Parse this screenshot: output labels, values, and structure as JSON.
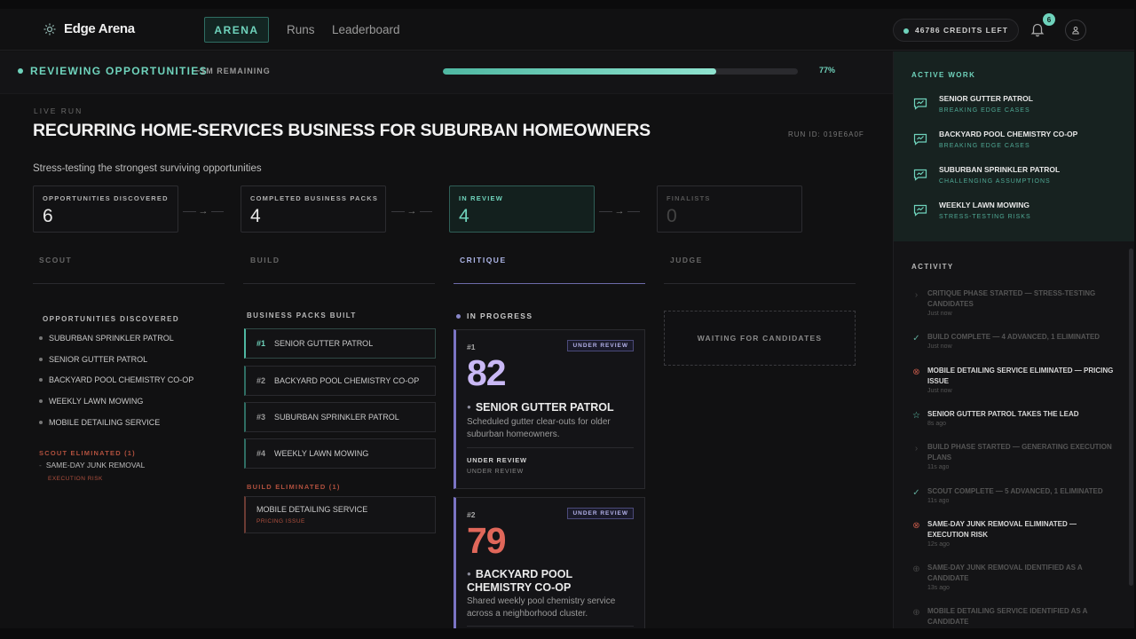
{
  "nav": {
    "brand": "Edge Arena",
    "tabs": [
      {
        "label": "ARENA",
        "active": true
      },
      {
        "label": "Runs"
      },
      {
        "label": "Leaderboard"
      }
    ],
    "credits": "46786 CREDITS LEFT",
    "notification_count": "6",
    "accent_color": "#6fd3bc"
  },
  "progress": {
    "title": "REVIEWING OPPORTUNITIES",
    "remaining": "~1M REMAINING",
    "percent_label": "77%",
    "percent_value": 0.77
  },
  "run": {
    "eyebrow": "LIVE RUN",
    "title": "RECURRING HOME-SERVICES BUSINESS FOR SUBURBAN HOMEOWNERS",
    "run_id": "RUN ID: 019E6A0F",
    "subtitle": "Stress-testing the strongest surviving opportunities"
  },
  "stats": [
    {
      "label": "OPPORTUNITIES DISCOVERED",
      "value": "6"
    },
    {
      "label": "COMPLETED BUSINESS PACKS",
      "value": "4"
    },
    {
      "label": "IN REVIEW",
      "value": "4"
    },
    {
      "label": "FINALISTS",
      "value": "0"
    }
  ],
  "arrow_glyph": "→",
  "phases": [
    "SCOUT",
    "BUILD",
    "CRITIQUE",
    "JUDGE"
  ],
  "scout": {
    "heading": "OPPORTUNITIES DISCOVERED",
    "items": [
      "SUBURBAN SPRINKLER PATROL",
      "SENIOR GUTTER PATROL",
      "BACKYARD POOL CHEMISTRY CO-OP",
      "WEEKLY LAWN MOWING",
      "MOBILE DETAILING SERVICE"
    ],
    "eliminated_heading": "SCOUT ELIMINATED (1)",
    "eliminated": {
      "name": "SAME-DAY JUNK REMOVAL",
      "reason": "EXECUTION RISK"
    }
  },
  "build": {
    "heading": "BUSINESS PACKS BUILT",
    "packs": [
      {
        "num": "#1",
        "name": "SENIOR GUTTER PATROL"
      },
      {
        "num": "#2",
        "name": "BACKYARD POOL CHEMISTRY CO-OP"
      },
      {
        "num": "#3",
        "name": "SUBURBAN SPRINKLER PATROL"
      },
      {
        "num": "#4",
        "name": "WEEKLY LAWN MOWING"
      }
    ],
    "eliminated_heading": "BUILD ELIMINATED (1)",
    "eliminated": {
      "name": "MOBILE DETAILING SERVICE",
      "reason": "PRICING ISSUE"
    }
  },
  "critique": {
    "heading": "IN PROGRESS",
    "cards": [
      {
        "rank": "#1",
        "badge": "UNDER REVIEW",
        "score": "82",
        "score_color": "#c9b8f5",
        "name": "SENIOR GUTTER PATROL",
        "desc": "Scheduled gutter clear-outs for older suburban homeowners.",
        "status": "UNDER REVIEW",
        "status_sub": "UNDER REVIEW"
      },
      {
        "rank": "#2",
        "badge": "UNDER REVIEW",
        "score": "79",
        "score_color": "#e0675a",
        "name": "BACKYARD POOL CHEMISTRY CO-OP",
        "desc": "Shared weekly pool chemistry service across a neighborhood cluster."
      }
    ]
  },
  "judge": {
    "waiting": "WAITING FOR CANDIDATES"
  },
  "active_work": {
    "heading": "ACTIVE WORK",
    "items": [
      {
        "name": "SENIOR GUTTER PATROL",
        "status": "BREAKING EDGE CASES"
      },
      {
        "name": "BACKYARD POOL CHEMISTRY CO-OP",
        "status": "BREAKING EDGE CASES"
      },
      {
        "name": "SUBURBAN SPRINKLER PATROL",
        "status": "CHALLENGING ASSUMPTIONS"
      },
      {
        "name": "WEEKLY LAWN MOWING",
        "status": "STRESS-TESTING RISKS"
      }
    ]
  },
  "activity": {
    "heading": "ACTIVITY",
    "items": [
      {
        "icon": "›",
        "text": "CRITIQUE PHASE STARTED — STRESS-TESTING CANDIDATES",
        "time": "Just now"
      },
      {
        "icon": "✓",
        "text": "BUILD COMPLETE — 4 ADVANCED, 1 ELIMINATED",
        "time": "Just now"
      },
      {
        "icon": "⊗",
        "text": "MOBILE DETAILING SERVICE ELIMINATED — PRICING ISSUE",
        "time": "Just now"
      },
      {
        "icon": "☆",
        "text": "SENIOR GUTTER PATROL TAKES THE LEAD",
        "time": "8s ago"
      },
      {
        "icon": "›",
        "text": "BUILD PHASE STARTED — GENERATING EXECUTION PLANS",
        "time": "11s ago"
      },
      {
        "icon": "✓",
        "text": "SCOUT COMPLETE — 5 ADVANCED, 1 ELIMINATED",
        "time": "11s ago"
      },
      {
        "icon": "⊗",
        "text": "SAME-DAY JUNK REMOVAL ELIMINATED — EXECUTION RISK",
        "time": "12s ago"
      },
      {
        "icon": "⊕",
        "text": "SAME-DAY JUNK REMOVAL IDENTIFIED AS A CANDIDATE",
        "time": "13s ago"
      },
      {
        "icon": "⊕",
        "text": "MOBILE DETAILING SERVICE IDENTIFIED AS A CANDIDATE",
        "time": ""
      }
    ]
  }
}
